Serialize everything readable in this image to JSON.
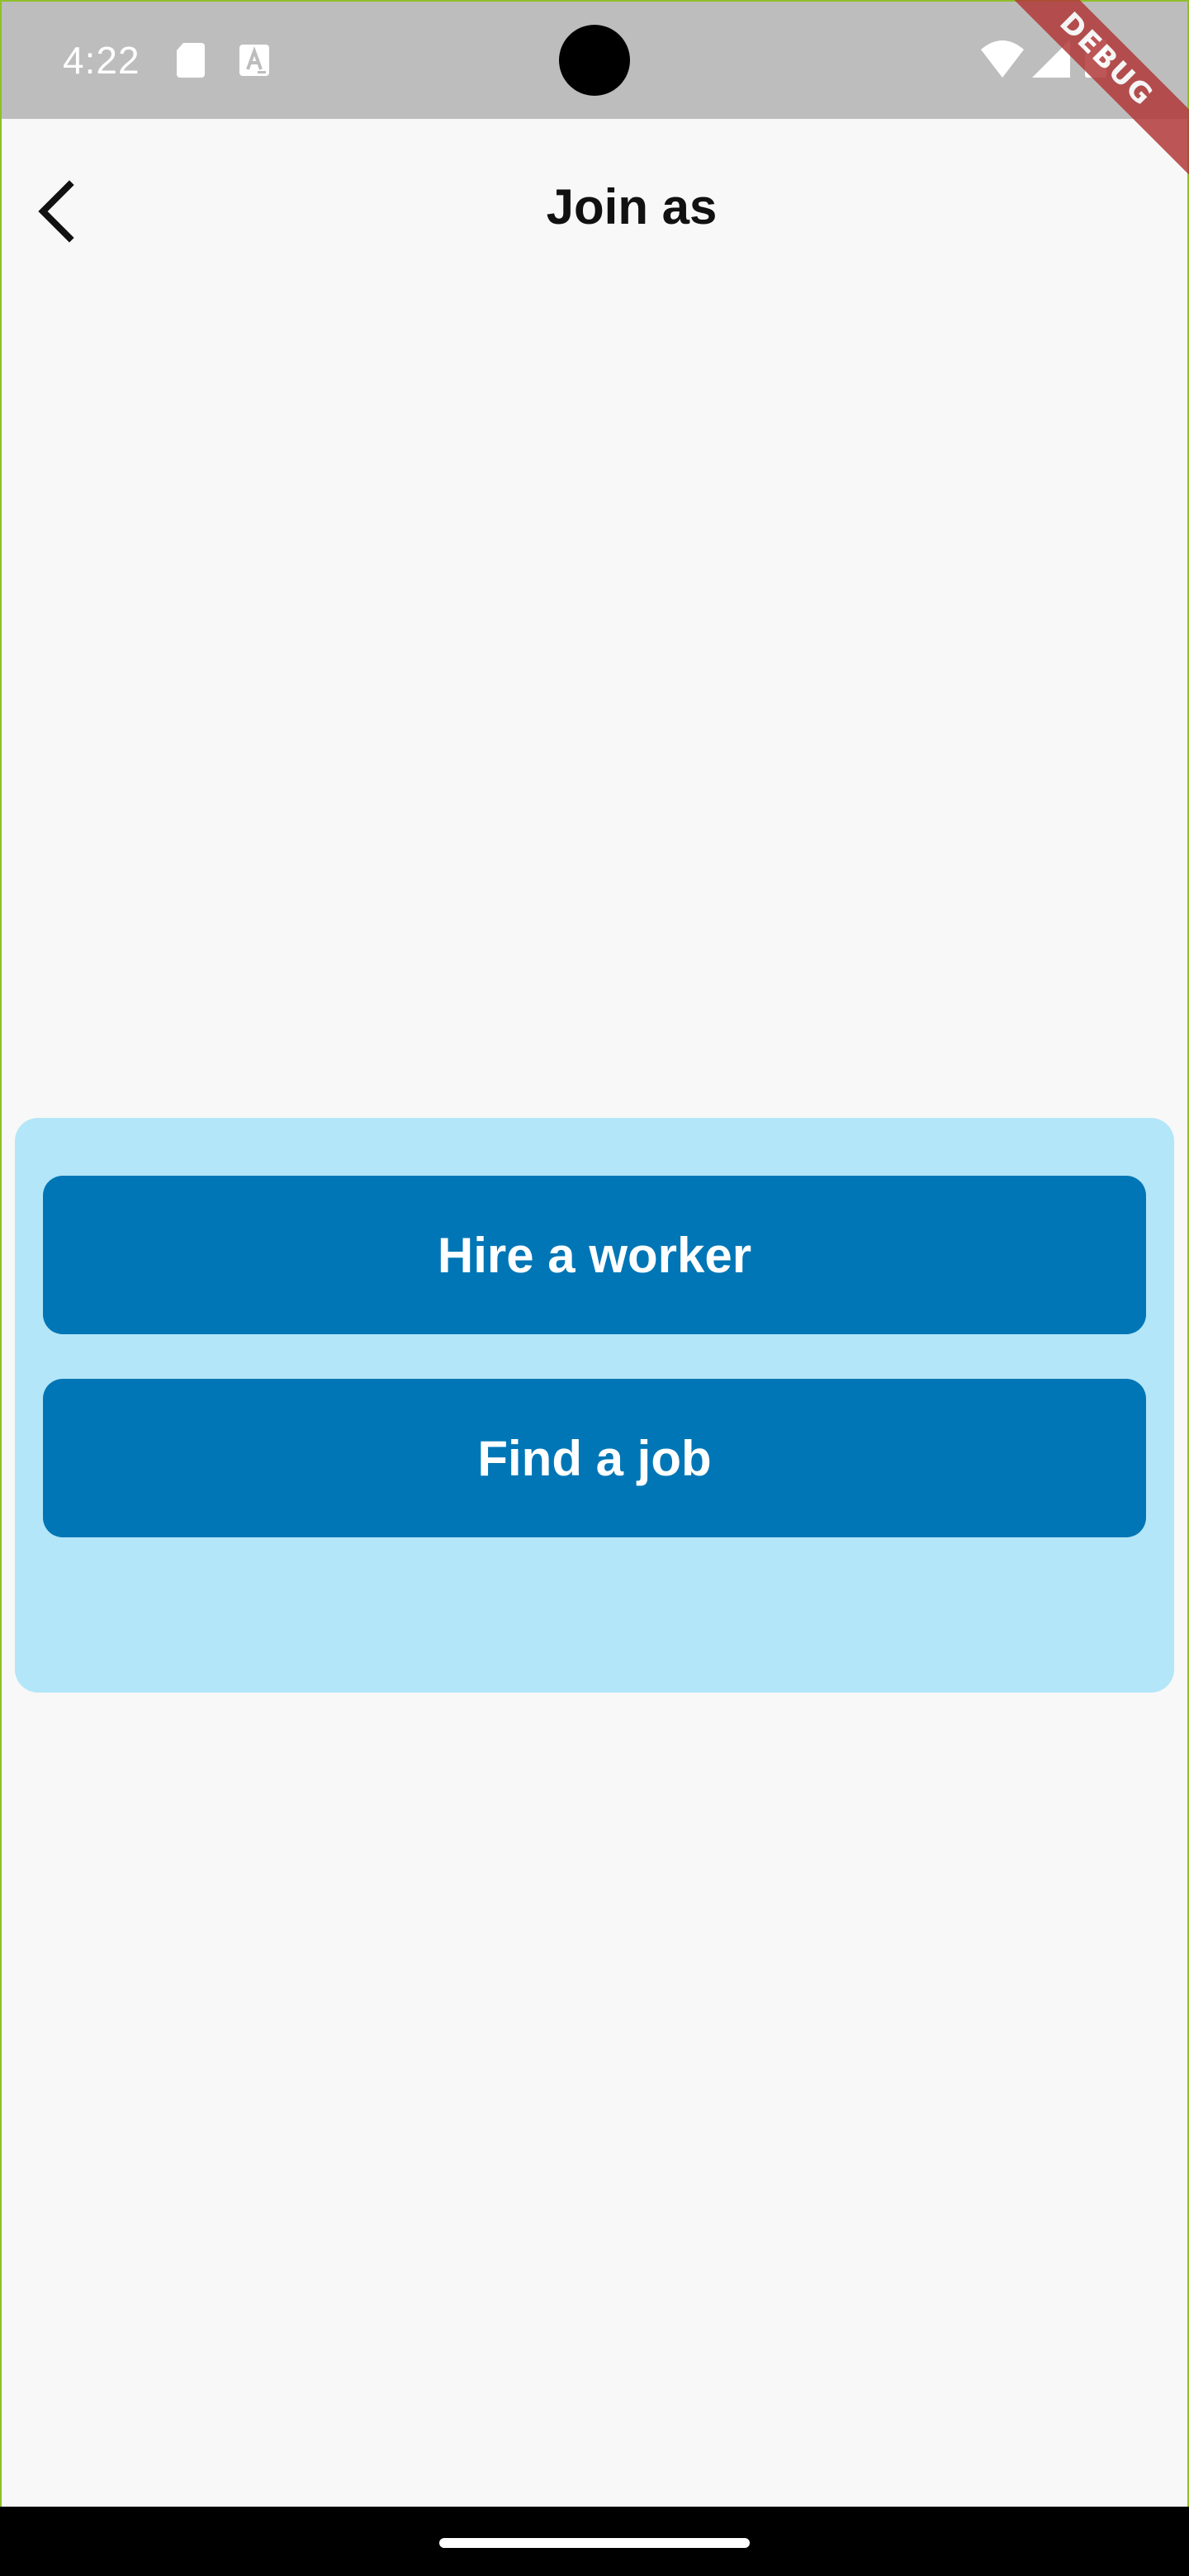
{
  "status_bar": {
    "time": "4:22",
    "icons": [
      "sd-card-icon",
      "text-a-icon",
      "wifi-icon",
      "signal-icon",
      "battery-icon"
    ]
  },
  "debug_banner": {
    "label": "DEBUG"
  },
  "app_bar": {
    "back_icon": "chevron-left-icon",
    "title": "Join as"
  },
  "join_card": {
    "hire_label": "Hire a worker",
    "find_label": "Find a job"
  },
  "colors": {
    "page_background": "#f8f8f8",
    "status_bar": "#bdbdbd",
    "card_background": "#b3e6f8",
    "button_background": "#0076b6",
    "button_text": "#ffffff",
    "debug_banner": "#b23a3a"
  }
}
